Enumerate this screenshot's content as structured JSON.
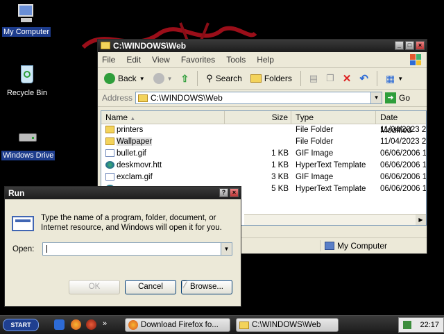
{
  "desktop": {
    "icons": [
      {
        "label": "My Computer",
        "icon": "computer-icon"
      },
      {
        "label": "Recycle Bin",
        "icon": "recycle-bin-icon"
      },
      {
        "label": "Windows Drive",
        "icon": "drive-icon"
      }
    ]
  },
  "explorer": {
    "title": "C:\\WINDOWS\\Web",
    "menu": [
      "File",
      "Edit",
      "View",
      "Favorites",
      "Tools",
      "Help"
    ],
    "toolbar": {
      "back": "Back",
      "search": "Search",
      "folders": "Folders"
    },
    "address_label": "Address",
    "address_value": "C:\\WINDOWS\\Web",
    "go_label": "Go",
    "columns": [
      "Name",
      "Size",
      "Type",
      "Date Modified"
    ],
    "rows": [
      {
        "name": "printers",
        "size": "",
        "type": "File Folder",
        "date": "11/04/2023 2",
        "icon": "folder"
      },
      {
        "name": "Wallpaper",
        "size": "",
        "type": "File Folder",
        "date": "11/04/2023 2",
        "icon": "folder"
      },
      {
        "name": "bullet.gif",
        "size": "1 KB",
        "type": "GIF Image",
        "date": "06/06/2006 1",
        "icon": "img"
      },
      {
        "name": "deskmovr.htt",
        "size": "1 KB",
        "type": "HyperText Template",
        "date": "06/06/2006 1",
        "icon": "web"
      },
      {
        "name": "exclam.gif",
        "size": "3 KB",
        "type": "GIF Image",
        "date": "06/06/2006 1",
        "icon": "img"
      },
      {
        "name": "",
        "size": "5 KB",
        "type": "HyperText Template",
        "date": "06/06/2006 1",
        "icon": "web"
      }
    ],
    "status_zone": "My Computer"
  },
  "run": {
    "title": "Run",
    "description": "Type the name of a program, folder, document, or Internet resource, and Windows will open it for you.",
    "open_label": "Open:",
    "open_value": "",
    "ok": "OK",
    "cancel": "Cancel",
    "browse": "Browse..."
  },
  "taskbar": {
    "start": "START",
    "tasks": [
      "Download Firefox fo...",
      "C:\\WINDOWS\\Web"
    ],
    "clock": "22:17"
  },
  "colors": {
    "accent": "#1d3c8c",
    "wallpaper_art": "#c1121f"
  }
}
